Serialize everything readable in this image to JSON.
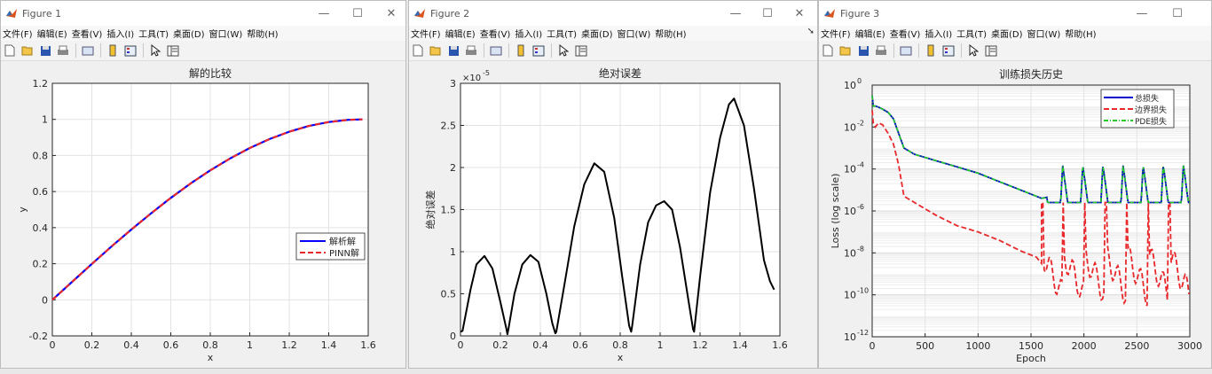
{
  "windows": [
    {
      "title": "Figure 1",
      "menus": [
        "文件(F)",
        "编辑(E)",
        "查看(V)",
        "插入(I)",
        "工具(T)",
        "桌面(D)",
        "窗口(W)",
        "帮助(H)"
      ],
      "chart": {
        "type": "line",
        "title": "解的比较",
        "xlabel": "x",
        "ylabel": "y",
        "x_ticks": [
          "0",
          "0.2",
          "0.4",
          "0.6",
          "0.8",
          "1",
          "1.2",
          "1.4",
          "1.6"
        ],
        "y_ticks": [
          "-0.2",
          "0",
          "0.2",
          "0.4",
          "0.6",
          "0.8",
          "1",
          "1.2"
        ],
        "legend": [
          "解析解",
          "PINN解"
        ],
        "value_labels": [
          {
            "x": 0,
            "y": 0
          },
          {
            "x": 0.2,
            "y": 0.199
          },
          {
            "x": 0.4,
            "y": 0.389
          },
          {
            "x": 0.6,
            "y": 0.565
          },
          {
            "x": 0.8,
            "y": 0.717
          },
          {
            "x": 1.0,
            "y": 0.841
          },
          {
            "x": 1.2,
            "y": 0.932
          },
          {
            "x": 1.4,
            "y": 0.985
          },
          {
            "x": 1.571,
            "y": 1.0
          }
        ]
      }
    },
    {
      "title": "Figure 2",
      "menus": [
        "文件(F)",
        "编辑(E)",
        "查看(V)",
        "插入(I)",
        "工具(T)",
        "桌面(D)",
        "窗口(W)",
        "帮助(H)"
      ],
      "chart": {
        "type": "line",
        "title": "绝对误差",
        "xlabel": "x",
        "ylabel": "绝对误差",
        "y_exponent": "×10",
        "y_exponent_power": "-5",
        "x_ticks": [
          "0",
          "0.2",
          "0.4",
          "0.6",
          "0.8",
          "1",
          "1.2",
          "1.4",
          "1.6"
        ],
        "y_ticks": [
          "0",
          "0.5",
          "1",
          "1.5",
          "2",
          "2.5",
          "3"
        ]
      }
    },
    {
      "title": "Figure 3",
      "menus": [
        "文件(F)",
        "编辑(E)",
        "查看(V)",
        "插入(I)",
        "工具(T)",
        "桌面(D)",
        "窗口(W)",
        "帮助(H)"
      ],
      "chart": {
        "type": "line",
        "title": "训练损失历史",
        "xlabel": "Epoch",
        "ylabel": "Loss (log scale)",
        "x_ticks": [
          "0",
          "500",
          "1000",
          "1500",
          "2000",
          "2500",
          "3000"
        ],
        "y_ticks_base": "10",
        "y_ticks_powers": [
          "-12",
          "-10",
          "-8",
          "-6",
          "-4",
          "-2",
          "0"
        ],
        "legend": [
          "总损失",
          "边界损失",
          "PDE损失"
        ]
      }
    }
  ],
  "chart_data": [
    {
      "type": "line",
      "title": "解的比较",
      "xlabel": "x",
      "ylabel": "y",
      "xlim": [
        0,
        1.6
      ],
      "ylim": [
        -0.2,
        1.2
      ],
      "grid": true,
      "legend_position": "right",
      "x": [
        0,
        0.1,
        0.2,
        0.3,
        0.4,
        0.5,
        0.6,
        0.7,
        0.8,
        0.9,
        1.0,
        1.1,
        1.2,
        1.3,
        1.4,
        1.5,
        1.571
      ],
      "series": [
        {
          "name": "解析解",
          "color": "#0000ff",
          "style": "solid",
          "values": [
            0,
            0.0998,
            0.1987,
            0.2955,
            0.3894,
            0.4794,
            0.5646,
            0.6442,
            0.7174,
            0.7833,
            0.8415,
            0.8912,
            0.932,
            0.9636,
            0.9854,
            0.9975,
            1.0
          ]
        },
        {
          "name": "PINN解",
          "color": "#e8282b",
          "style": "dashed",
          "values": [
            0,
            0.0998,
            0.1987,
            0.2955,
            0.3894,
            0.4794,
            0.5646,
            0.6442,
            0.7174,
            0.7833,
            0.8415,
            0.8912,
            0.932,
            0.9636,
            0.9854,
            0.9975,
            1.0
          ]
        }
      ]
    },
    {
      "type": "line",
      "title": "绝对误差",
      "xlabel": "x",
      "ylabel": "绝对误差",
      "xlim": [
        0,
        1.6
      ],
      "ylim": [
        0,
        3
      ],
      "y_scale_note": "×10^-5",
      "grid": true,
      "x": [
        0,
        0.01,
        0.05,
        0.08,
        0.12,
        0.16,
        0.2,
        0.23,
        0.235,
        0.24,
        0.27,
        0.31,
        0.35,
        0.39,
        0.43,
        0.46,
        0.475,
        0.48,
        0.52,
        0.57,
        0.62,
        0.67,
        0.72,
        0.77,
        0.81,
        0.845,
        0.855,
        0.86,
        0.9,
        0.94,
        0.98,
        1.02,
        1.06,
        1.1,
        1.14,
        1.165,
        1.17,
        1.2,
        1.25,
        1.3,
        1.345,
        1.37,
        1.42,
        1.47,
        1.52,
        1.55,
        1.571
      ],
      "series": [
        {
          "name": "",
          "color": "#000000",
          "style": "solid",
          "values": [
            0.05,
            0.06,
            0.55,
            0.85,
            0.95,
            0.8,
            0.4,
            0.08,
            0.02,
            0.08,
            0.5,
            0.85,
            0.96,
            0.88,
            0.5,
            0.15,
            0.03,
            0.05,
            0.6,
            1.3,
            1.8,
            2.05,
            1.95,
            1.4,
            0.7,
            0.12,
            0.05,
            0.12,
            0.85,
            1.35,
            1.55,
            1.6,
            1.5,
            1.05,
            0.45,
            0.08,
            0.05,
            0.7,
            1.7,
            2.35,
            2.75,
            2.82,
            2.5,
            1.75,
            0.9,
            0.65,
            0.55
          ]
        }
      ]
    },
    {
      "type": "line",
      "title": "训练损失历史",
      "xlabel": "Epoch",
      "ylabel": "Loss (log scale)",
      "xlim": [
        0,
        3000
      ],
      "ylim_log10": [
        -12,
        0
      ],
      "y_scale": "log",
      "grid": true,
      "legend_position": "top-right",
      "x": [
        0,
        10,
        30,
        60,
        100,
        150,
        200,
        250,
        300,
        400,
        600,
        800,
        1000,
        1200,
        1400,
        1550,
        1600,
        1700,
        1800,
        1900,
        2000,
        2100,
        2200,
        2300,
        2400,
        2500,
        2600,
        2700,
        2800,
        2900,
        3000
      ],
      "series": [
        {
          "name": "总损失",
          "color": "#0000cc",
          "style": "solid",
          "values_log10": [
            -0.5,
            -1.0,
            -1.0,
            -1.05,
            -1.15,
            -1.3,
            -1.6,
            -2.3,
            -3.0,
            -3.3,
            -3.6,
            -3.9,
            -4.2,
            -4.6,
            -5.0,
            -5.3,
            -5.4,
            -5.5,
            -5.55,
            -5.6,
            -5.6,
            -5.6,
            -5.6,
            -5.6,
            -5.6,
            -5.6,
            -5.6,
            -5.6,
            -5.6,
            -5.6,
            -5.6
          ]
        },
        {
          "name": "边界损失",
          "color": "#e8282b",
          "style": "dashed",
          "values_log10": [
            -1.2,
            -1.8,
            -2.0,
            -1.8,
            -1.9,
            -2.3,
            -2.8,
            -3.8,
            -5.3,
            -5.6,
            -6.2,
            -6.7,
            -7.0,
            -7.4,
            -7.9,
            -8.2,
            -8.5,
            -9.0,
            -9.3,
            -9.0,
            -9.3,
            -9.5,
            -9.2,
            -9.4,
            -9.1,
            -9.5,
            -9.0,
            -9.3,
            -9.2,
            -9.6,
            -9.1
          ]
        },
        {
          "name": "PDE损失",
          "color": "#22cc22",
          "style": "dashdot",
          "values_log10": [
            -0.5,
            -1.0,
            -1.0,
            -1.05,
            -1.15,
            -1.3,
            -1.6,
            -2.3,
            -3.0,
            -3.3,
            -3.6,
            -3.9,
            -4.2,
            -4.6,
            -5.0,
            -5.3,
            -5.4,
            -5.5,
            -5.55,
            -5.6,
            -5.6,
            -5.6,
            -5.6,
            -5.6,
            -5.6,
            -5.6,
            -5.6,
            -5.6,
            -5.6,
            -5.6,
            -5.6
          ]
        }
      ]
    }
  ]
}
